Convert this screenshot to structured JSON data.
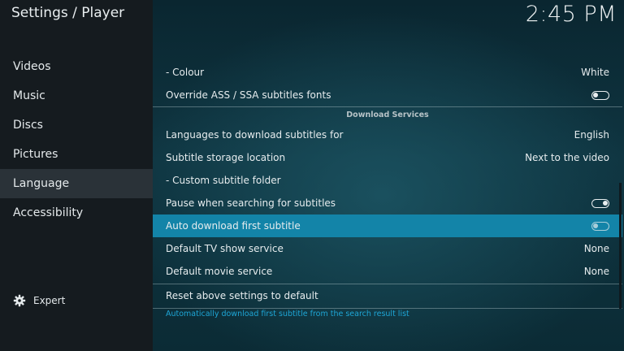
{
  "header": {
    "title": "Settings / Player",
    "time": "2:45 PM"
  },
  "sidebar": {
    "items": [
      {
        "label": "Videos"
      },
      {
        "label": "Music"
      },
      {
        "label": "Discs"
      },
      {
        "label": "Pictures"
      },
      {
        "label": "Language"
      },
      {
        "label": "Accessibility"
      }
    ],
    "active": "Language",
    "expert_label": "Expert"
  },
  "settings": {
    "rows": [
      {
        "label": "- Colour",
        "value": "White"
      },
      {
        "label": "Override ASS / SSA subtitles fonts",
        "toggle": "off"
      },
      {
        "label": "Languages to download subtitles for",
        "value": "English"
      },
      {
        "label": "Subtitle storage location",
        "value": "Next to the video"
      },
      {
        "label": "- Custom subtitle folder",
        "value": ""
      },
      {
        "label": "Pause when searching for subtitles",
        "toggle": "on"
      },
      {
        "label": "Auto download first subtitle",
        "toggle": "off"
      },
      {
        "label": "Default TV show service",
        "value": "None"
      },
      {
        "label": "Default movie service",
        "value": "None"
      },
      {
        "label": "Reset above settings to default",
        "value": ""
      }
    ],
    "group_header": "Download Services",
    "focused": "Auto download first subtitle"
  },
  "description": "Automatically download first subtitle from the search result list",
  "colors": {
    "accent": "#1384a8",
    "sidebar_bg": "#151b1f",
    "description": "#1ea6d6"
  }
}
